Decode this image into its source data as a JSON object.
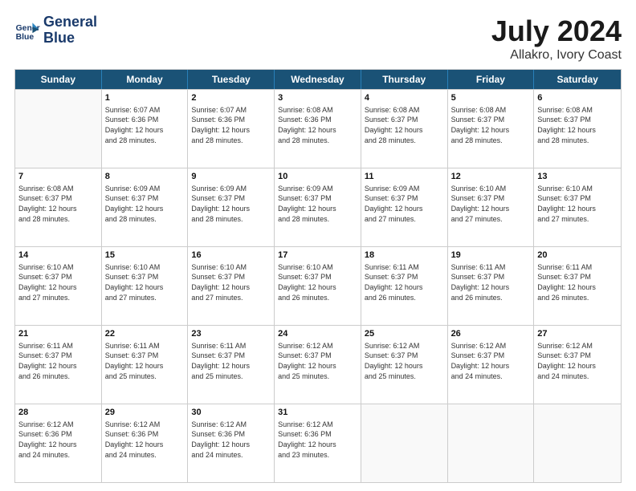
{
  "logo": {
    "line1": "General",
    "line2": "Blue"
  },
  "title": "July 2024",
  "subtitle": "Allakro, Ivory Coast",
  "days": [
    "Sunday",
    "Monday",
    "Tuesday",
    "Wednesday",
    "Thursday",
    "Friday",
    "Saturday"
  ],
  "weeks": [
    [
      {
        "day": "",
        "info": ""
      },
      {
        "day": "1",
        "info": "Sunrise: 6:07 AM\nSunset: 6:36 PM\nDaylight: 12 hours\nand 28 minutes."
      },
      {
        "day": "2",
        "info": "Sunrise: 6:07 AM\nSunset: 6:36 PM\nDaylight: 12 hours\nand 28 minutes."
      },
      {
        "day": "3",
        "info": "Sunrise: 6:08 AM\nSunset: 6:36 PM\nDaylight: 12 hours\nand 28 minutes."
      },
      {
        "day": "4",
        "info": "Sunrise: 6:08 AM\nSunset: 6:37 PM\nDaylight: 12 hours\nand 28 minutes."
      },
      {
        "day": "5",
        "info": "Sunrise: 6:08 AM\nSunset: 6:37 PM\nDaylight: 12 hours\nand 28 minutes."
      },
      {
        "day": "6",
        "info": "Sunrise: 6:08 AM\nSunset: 6:37 PM\nDaylight: 12 hours\nand 28 minutes."
      }
    ],
    [
      {
        "day": "7",
        "info": "Sunrise: 6:08 AM\nSunset: 6:37 PM\nDaylight: 12 hours\nand 28 minutes."
      },
      {
        "day": "8",
        "info": "Sunrise: 6:09 AM\nSunset: 6:37 PM\nDaylight: 12 hours\nand 28 minutes."
      },
      {
        "day": "9",
        "info": "Sunrise: 6:09 AM\nSunset: 6:37 PM\nDaylight: 12 hours\nand 28 minutes."
      },
      {
        "day": "10",
        "info": "Sunrise: 6:09 AM\nSunset: 6:37 PM\nDaylight: 12 hours\nand 28 minutes."
      },
      {
        "day": "11",
        "info": "Sunrise: 6:09 AM\nSunset: 6:37 PM\nDaylight: 12 hours\nand 27 minutes."
      },
      {
        "day": "12",
        "info": "Sunrise: 6:10 AM\nSunset: 6:37 PM\nDaylight: 12 hours\nand 27 minutes."
      },
      {
        "day": "13",
        "info": "Sunrise: 6:10 AM\nSunset: 6:37 PM\nDaylight: 12 hours\nand 27 minutes."
      }
    ],
    [
      {
        "day": "14",
        "info": "Sunrise: 6:10 AM\nSunset: 6:37 PM\nDaylight: 12 hours\nand 27 minutes."
      },
      {
        "day": "15",
        "info": "Sunrise: 6:10 AM\nSunset: 6:37 PM\nDaylight: 12 hours\nand 27 minutes."
      },
      {
        "day": "16",
        "info": "Sunrise: 6:10 AM\nSunset: 6:37 PM\nDaylight: 12 hours\nand 27 minutes."
      },
      {
        "day": "17",
        "info": "Sunrise: 6:10 AM\nSunset: 6:37 PM\nDaylight: 12 hours\nand 26 minutes."
      },
      {
        "day": "18",
        "info": "Sunrise: 6:11 AM\nSunset: 6:37 PM\nDaylight: 12 hours\nand 26 minutes."
      },
      {
        "day": "19",
        "info": "Sunrise: 6:11 AM\nSunset: 6:37 PM\nDaylight: 12 hours\nand 26 minutes."
      },
      {
        "day": "20",
        "info": "Sunrise: 6:11 AM\nSunset: 6:37 PM\nDaylight: 12 hours\nand 26 minutes."
      }
    ],
    [
      {
        "day": "21",
        "info": "Sunrise: 6:11 AM\nSunset: 6:37 PM\nDaylight: 12 hours\nand 26 minutes."
      },
      {
        "day": "22",
        "info": "Sunrise: 6:11 AM\nSunset: 6:37 PM\nDaylight: 12 hours\nand 25 minutes."
      },
      {
        "day": "23",
        "info": "Sunrise: 6:11 AM\nSunset: 6:37 PM\nDaylight: 12 hours\nand 25 minutes."
      },
      {
        "day": "24",
        "info": "Sunrise: 6:12 AM\nSunset: 6:37 PM\nDaylight: 12 hours\nand 25 minutes."
      },
      {
        "day": "25",
        "info": "Sunrise: 6:12 AM\nSunset: 6:37 PM\nDaylight: 12 hours\nand 25 minutes."
      },
      {
        "day": "26",
        "info": "Sunrise: 6:12 AM\nSunset: 6:37 PM\nDaylight: 12 hours\nand 24 minutes."
      },
      {
        "day": "27",
        "info": "Sunrise: 6:12 AM\nSunset: 6:37 PM\nDaylight: 12 hours\nand 24 minutes."
      }
    ],
    [
      {
        "day": "28",
        "info": "Sunrise: 6:12 AM\nSunset: 6:36 PM\nDaylight: 12 hours\nand 24 minutes."
      },
      {
        "day": "29",
        "info": "Sunrise: 6:12 AM\nSunset: 6:36 PM\nDaylight: 12 hours\nand 24 minutes."
      },
      {
        "day": "30",
        "info": "Sunrise: 6:12 AM\nSunset: 6:36 PM\nDaylight: 12 hours\nand 24 minutes."
      },
      {
        "day": "31",
        "info": "Sunrise: 6:12 AM\nSunset: 6:36 PM\nDaylight: 12 hours\nand 23 minutes."
      },
      {
        "day": "",
        "info": ""
      },
      {
        "day": "",
        "info": ""
      },
      {
        "day": "",
        "info": ""
      }
    ]
  ]
}
